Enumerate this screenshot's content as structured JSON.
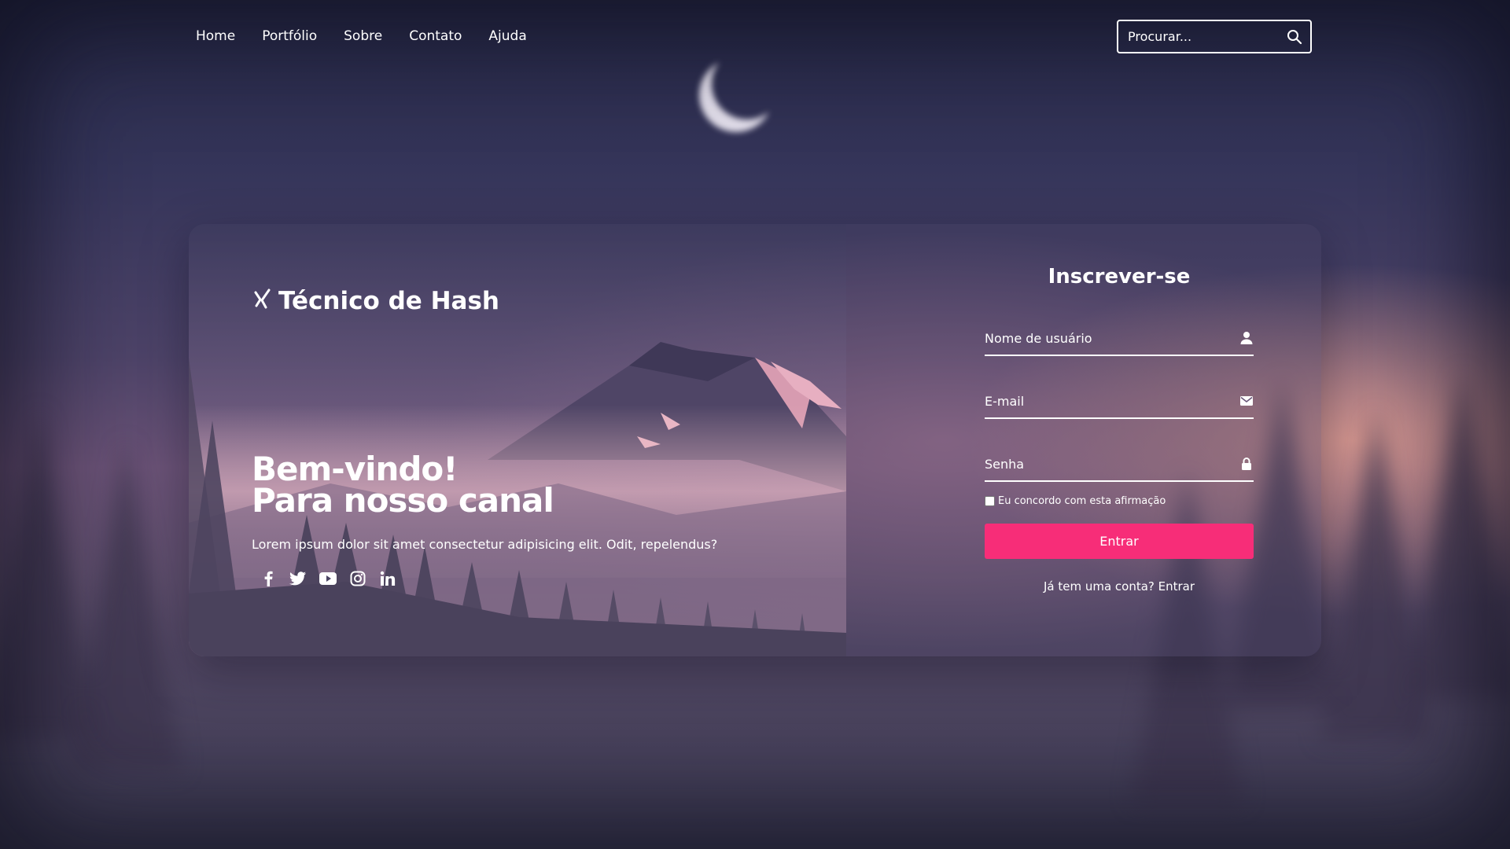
{
  "nav": {
    "items": [
      "Home",
      "Portfólio",
      "Sobre",
      "Contato",
      "Ajuda"
    ]
  },
  "search": {
    "placeholder": "Procurar...",
    "icon": "search-icon"
  },
  "brand": {
    "name": "Técnico de Hash",
    "logo_icon": "xing-icon"
  },
  "hero": {
    "line1": "Bem-vindo!",
    "line2": "Para nosso canal",
    "lead": "Lorem ipsum dolor sit amet consectetur adipisicing elit. Odit, repelendus?",
    "social_icons": [
      "facebook-icon",
      "twitter-icon",
      "youtube-icon",
      "instagram-icon",
      "linkedin-icon"
    ]
  },
  "form": {
    "title": "Inscrever-se",
    "username_placeholder": "Nome de usuário",
    "email_placeholder": "E-mail",
    "password_placeholder": "Senha",
    "agree_label": "Eu concordo com esta afirmação",
    "agree_checked": false,
    "submit_label": "Entrar",
    "login_prompt": "Já tem uma conta? Entrar"
  },
  "colors": {
    "accent": "#f72d78"
  }
}
